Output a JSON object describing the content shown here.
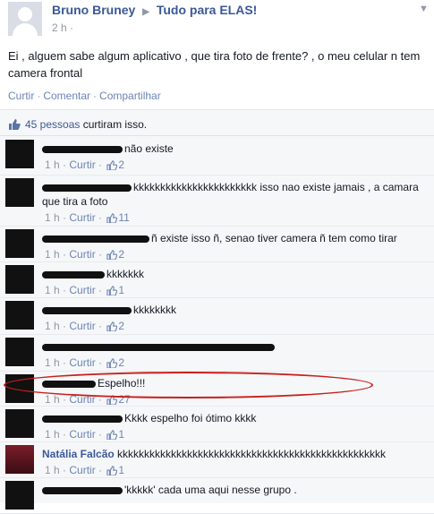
{
  "post": {
    "author": "Bruno Bruney",
    "group": "Tudo para ELAS!",
    "time": "2 h",
    "text": "Ei , alguem sabe algum aplicativo , que tira foto de frente? , o meu celular n tem camera frontal",
    "actions": [
      "Curtir",
      "Comentar",
      "Compartilhar"
    ]
  },
  "likes": {
    "people": "45 pessoas",
    "suffix": "curtiram isso."
  },
  "comments": [
    {
      "author": "",
      "text": "não existe",
      "time": "1 h",
      "like_label": "Curtir",
      "likes": "2"
    },
    {
      "author": "",
      "text": "kkkkkkkkkkkkkkkkkkkkkkk isso nao existe jamais , a camara que tira a foto",
      "time": "1 h",
      "like_label": "Curtir",
      "likes": "11"
    },
    {
      "author": "",
      "text": "ñ existe isso ñ, senao tiver camera ñ tem como tirar",
      "time": "1 h",
      "like_label": "Curtir",
      "likes": "2"
    },
    {
      "author": "",
      "text": "kkkkkkk",
      "time": "1 h",
      "like_label": "Curtir",
      "likes": "1"
    },
    {
      "author": "",
      "text": "kkkkkkkk",
      "time": "1 h",
      "like_label": "Curtir",
      "likes": "2"
    },
    {
      "author": "",
      "text": "",
      "time": "1 h",
      "like_label": "Curtir",
      "likes": "2"
    },
    {
      "author": "",
      "text": "Espelho!!!",
      "time": "1 h",
      "like_label": "Curtir",
      "likes": "27"
    },
    {
      "author": "",
      "text": "Kkkk espelho foi ótimo kkkk",
      "time": "1 h",
      "like_label": "Curtir",
      "likes": "1"
    },
    {
      "author": "Natália Falcão",
      "text": "kkkkkkkkkkkkkkkkkkkkkkkkkkkkkkkkkkkkkkkkkkkkkkkkkk",
      "time": "1 h",
      "like_label": "Curtir",
      "likes": "1"
    },
    {
      "author": "",
      "text": "'kkkkk' cada uma aqui nesse grupo .",
      "time": "",
      "like_label": "",
      "likes": ""
    }
  ],
  "colors": {
    "link": "#3b5998",
    "muted": "#9197a3",
    "highlight": "#c8201c"
  }
}
